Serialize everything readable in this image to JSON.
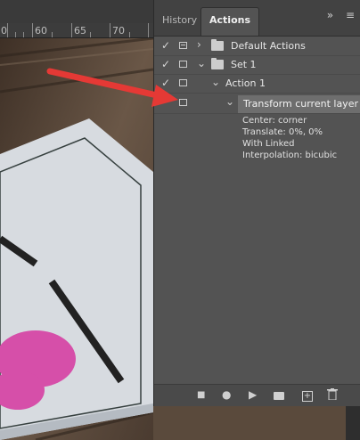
{
  "ruler": {
    "labels": [
      "0",
      "60",
      "65",
      "70"
    ]
  },
  "panel": {
    "tabs": [
      {
        "label": "History"
      },
      {
        "label": "Actions"
      }
    ],
    "tools": {
      "expand": "»",
      "menu": "≡"
    },
    "rows": [
      {
        "check": "✓",
        "caret": "›",
        "label": "Default Actions"
      },
      {
        "check": "✓",
        "caret": "⌄",
        "label": "Set 1"
      },
      {
        "check": "✓",
        "caret": "⌄",
        "label": "Action 1"
      },
      {
        "check": "",
        "caret": "⌄",
        "label": "Transform current layer"
      }
    ],
    "details": [
      "Center: corner",
      "Translate: 0%, 0%",
      "With Linked",
      "Interpolation: bicubic"
    ],
    "bottom_buttons": [
      "■",
      "●",
      "▶",
      "",
      "+",
      ""
    ]
  },
  "colors": {
    "arrow": "#e53935",
    "highlight": "#6e6e6e",
    "panel_bg": "#535353"
  }
}
